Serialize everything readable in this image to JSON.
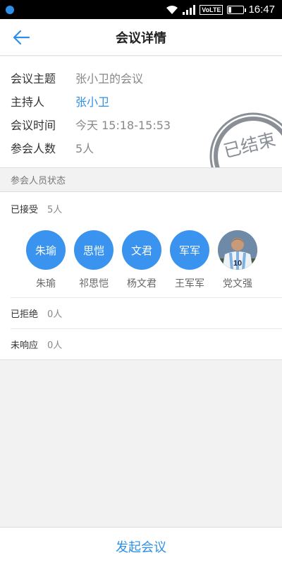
{
  "status_bar": {
    "network_badge": "VoLTE",
    "time": "16:47",
    "battery_level": 0.2
  },
  "nav": {
    "title": "会议详情",
    "back_icon": "back-arrow-icon"
  },
  "meeting": {
    "topic_label": "会议主题",
    "topic": "张小卫的会议",
    "host_label": "主持人",
    "host": "张小卫",
    "time_label": "会议时间",
    "time": "今天 15:18-15:53",
    "count_label": "参会人数",
    "count": "5人",
    "stamp": "已结束"
  },
  "attendee_status": {
    "section_title": "参会人员状态",
    "accepted": {
      "label": "已接受",
      "count": "5人",
      "people": [
        {
          "avatar_text": "朱瑜",
          "name": "朱瑜"
        },
        {
          "avatar_text": "思恺",
          "name": "祁思恺"
        },
        {
          "avatar_text": "文君",
          "name": "杨文君"
        },
        {
          "avatar_text": "军军",
          "name": "王军军"
        },
        {
          "avatar_text": "",
          "name": "党文强",
          "photo": true
        }
      ]
    },
    "declined": {
      "label": "已拒绝",
      "count": "0人"
    },
    "no_response": {
      "label": "未响应",
      "count": "0人"
    }
  },
  "actions": {
    "start_meeting": "发起会议"
  },
  "colors": {
    "accent": "#2f8fe8",
    "avatar_bg": "#3a93ee",
    "stamp": "#8a8f96"
  }
}
